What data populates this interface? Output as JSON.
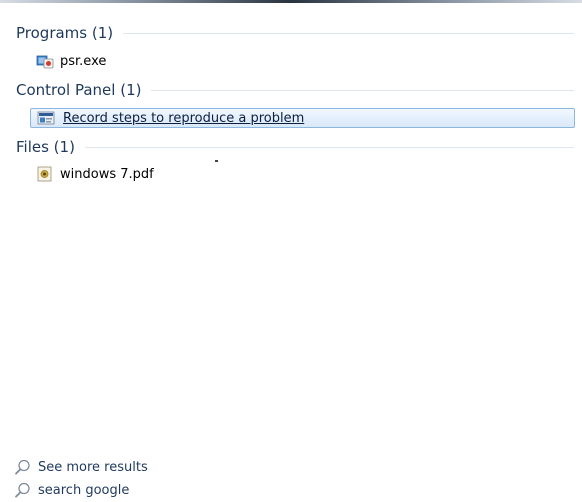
{
  "groups": {
    "programs": {
      "title": "Programs (1)",
      "items": [
        {
          "label": "psr.exe",
          "icon": "program-icon"
        }
      ]
    },
    "control_panel": {
      "title": "Control Panel (1)",
      "items": [
        {
          "label": "Record steps to reproduce a problem",
          "icon": "control-panel-icon",
          "selected": true
        }
      ]
    },
    "files": {
      "title": "Files (1)",
      "items": [
        {
          "label": "windows 7.pdf",
          "icon": "pdf-file-icon"
        }
      ]
    }
  },
  "footer": {
    "see_more": {
      "label": "See more results",
      "icon": "search-icon"
    },
    "search_web": {
      "label": "search google",
      "icon": "search-icon"
    }
  },
  "colors": {
    "header_text": "#1e395b",
    "selection_border": "#8eb7e0",
    "selection_fill": "#d9e8fb"
  }
}
